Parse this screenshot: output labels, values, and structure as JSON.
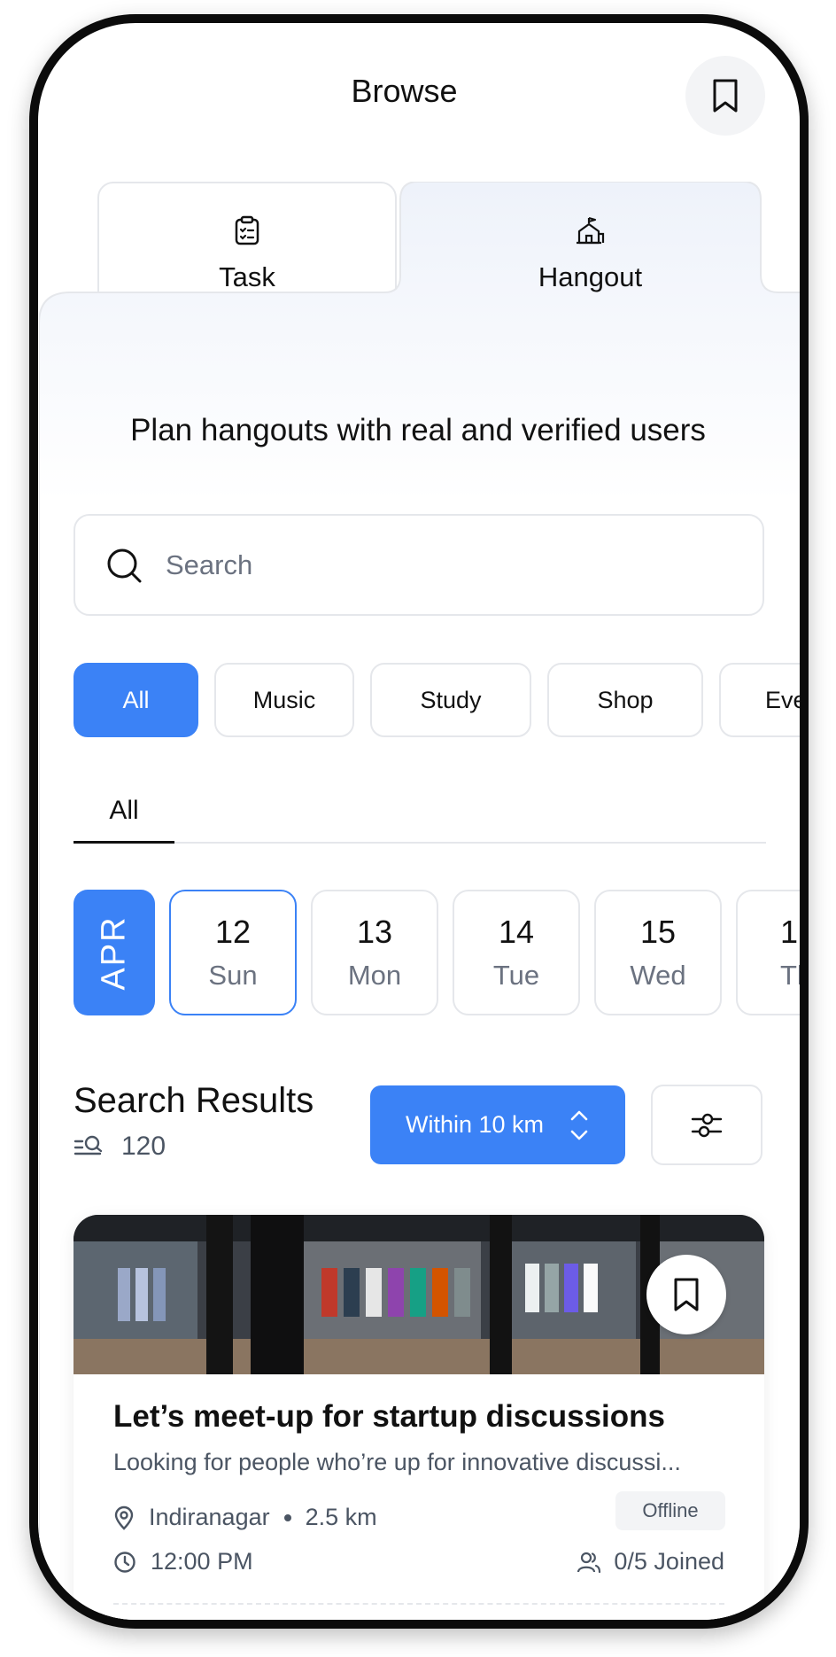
{
  "header": {
    "title": "Browse",
    "bookmark_icon": "bookmark-icon"
  },
  "tabs": [
    {
      "label": "Task",
      "icon": "clipboard-checklist-icon",
      "active": false
    },
    {
      "label": "Hangout",
      "icon": "venue-building-icon",
      "active": true
    }
  ],
  "tagline": "Plan hangouts with real and verified users",
  "search": {
    "placeholder": "Search",
    "value": ""
  },
  "categories": [
    "All",
    "Music",
    "Study",
    "Shop",
    "Eve"
  ],
  "subtab": "All",
  "calendar": {
    "month": "APR",
    "dates": [
      {
        "num": "12",
        "day": "Sun",
        "selected": true
      },
      {
        "num": "13",
        "day": "Mon",
        "selected": false
      },
      {
        "num": "14",
        "day": "Tue",
        "selected": false
      },
      {
        "num": "15",
        "day": "Wed",
        "selected": false
      },
      {
        "num": "1",
        "day": "Th",
        "selected": false
      }
    ]
  },
  "results": {
    "title": "Search Results",
    "count": "120",
    "range_label": "Within 10 km"
  },
  "card": {
    "title": "Let’s meet-up for startup discussions",
    "description": "Looking for people who’re up for innovative discussi...",
    "location": "Indiranagar",
    "distance": "2.5 km",
    "mode": "Offline",
    "time": "12:00 PM",
    "joined": "0/5 Joined"
  },
  "colors": {
    "accent": "#3b82f6",
    "border": "#e5e7eb",
    "panel_top": "#eef2fa"
  }
}
